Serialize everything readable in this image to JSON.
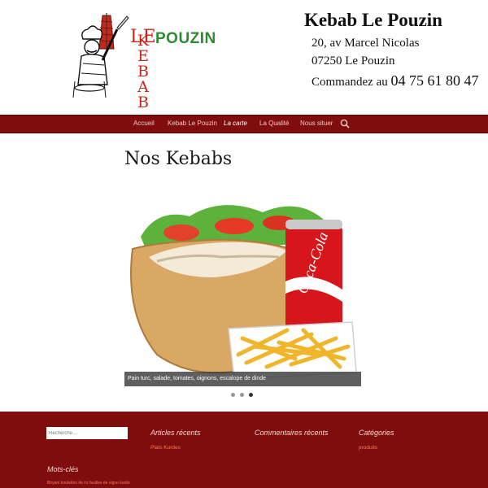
{
  "header": {
    "logo": {
      "word_le": "LE",
      "word_pouzin": "POUZIN",
      "letters_vertical": [
        "K",
        "E",
        "B",
        "A",
        "B"
      ]
    },
    "site_title": "Kebab Le Pouzin",
    "address_line1": "20, av Marcel Nicolas",
    "address_line2": "07250 Le Pouzin",
    "order_prefix": "Commandez au",
    "phone": "04 75 61 80 47"
  },
  "nav": {
    "items": [
      {
        "label": "Accueil"
      },
      {
        "label": "Kebab Le Pouzin"
      },
      {
        "label": "La carte"
      },
      {
        "label": "La Qualité"
      },
      {
        "label": "Nous situer"
      }
    ],
    "search_icon": "search-icon"
  },
  "main": {
    "title": "Nos Kebabs",
    "slider": {
      "caption": "Pain turc, salade, tomates, oignons, escalope de dinde",
      "slide_count": 3,
      "active_index": 2,
      "can_text": "Coca-Cola"
    }
  },
  "footer": {
    "search_placeholder": "Recherche…",
    "widgets": [
      {
        "title": "Articles récents",
        "link": "Plats Kurdes"
      },
      {
        "title": "Commentaires récents",
        "link": ""
      },
      {
        "title": "Catégories",
        "link": "produits"
      }
    ],
    "tags_title": "Mots-clés",
    "tags_line": "Biryani boulettes de riz feuilles de vigne kurde"
  },
  "colors": {
    "brand_red": "#7f0d0d",
    "logo_red": "#c8281c",
    "logo_green": "#2e8b32",
    "link_orange": "#ff7a5a"
  }
}
